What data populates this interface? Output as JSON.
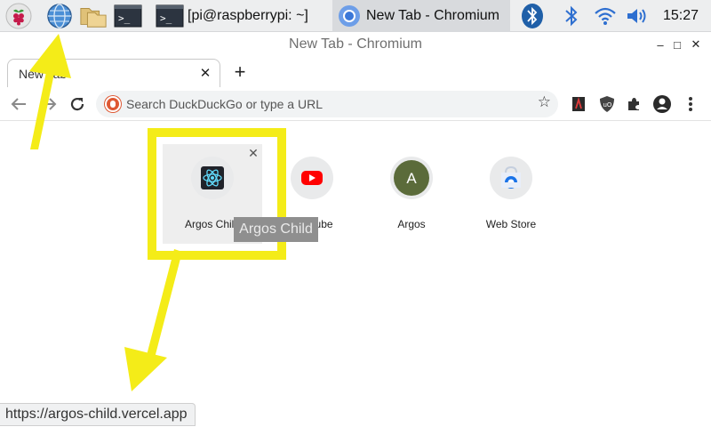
{
  "taskbar": {
    "tasks": [
      {
        "label": "[pi@raspberrypi: ~]",
        "icon": "terminal-icon"
      },
      {
        "label": "New Tab - Chromium",
        "icon": "chromium-icon"
      }
    ],
    "clock": "15:27"
  },
  "window": {
    "title": "New Tab - Chromium",
    "controls": {
      "minimize": "‒",
      "maximize": "□",
      "close": "✕"
    }
  },
  "tabs": [
    {
      "title": "New Tab",
      "active": true
    }
  ],
  "omnibox": {
    "placeholder": "Search DuckDuckGo or type a URL"
  },
  "shortcuts": [
    {
      "label": "Argos Child",
      "icon": "react-atom-icon",
      "hovered": true
    },
    {
      "label": "YouTube",
      "icon": "youtube-icon"
    },
    {
      "label": "Argos",
      "icon": "letter-a-icon",
      "letter": "A"
    },
    {
      "label": "Web Store",
      "icon": "chrome-web-store-icon"
    }
  ],
  "tooltip": "Argos Child",
  "status_url": "https://argos-child.vercel.app",
  "colors": {
    "annotation": "#f4ec18",
    "argos_avatar": "#5b6b3a",
    "youtube": "#ff0000",
    "ddg": "#de5833"
  }
}
